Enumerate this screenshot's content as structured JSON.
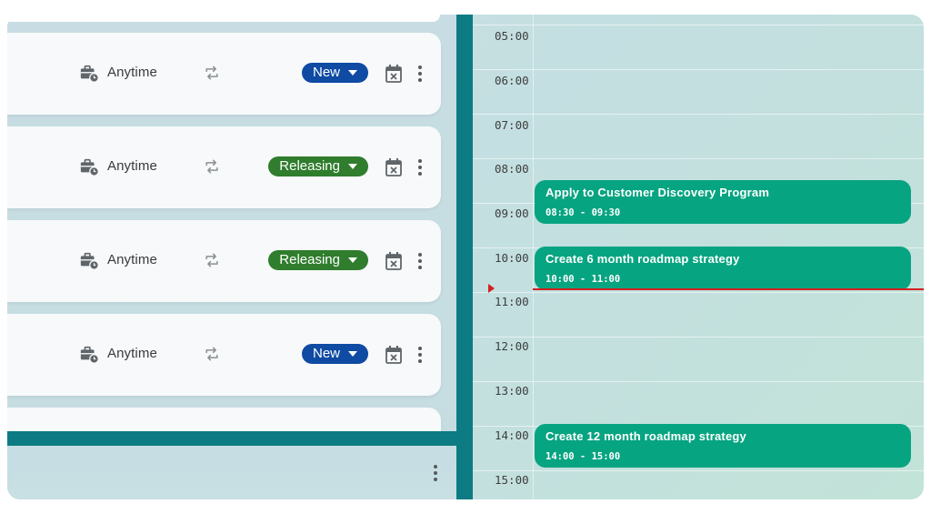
{
  "tasks": [
    {
      "when": "Anytime",
      "status": "New",
      "status_color": "#0f4aa3"
    },
    {
      "when": "Anytime",
      "status": "Releasing",
      "status_color": "#2f7d2d"
    },
    {
      "when": "Anytime",
      "status": "Releasing",
      "status_color": "#2f7d2d"
    },
    {
      "when": "Anytime",
      "status": "New",
      "status_color": "#0f4aa3"
    }
  ],
  "icons": {
    "schedule": "briefcase-clock-icon",
    "repeat": "repeat-icon",
    "calendar": "calendar-remove-icon",
    "menu": "more-vert-icon",
    "dropdown": "caret-down-icon"
  },
  "calendar": {
    "hours": [
      "05:00",
      "06:00",
      "07:00",
      "08:00",
      "09:00",
      "10:00",
      "11:00",
      "12:00",
      "13:00",
      "14:00",
      "15:00"
    ],
    "events": [
      {
        "title": "Apply to Customer Discovery Program",
        "time": "08:30 - 09:30"
      },
      {
        "title": "Create 6 month roadmap strategy",
        "time": "10:00 - 11:00"
      },
      {
        "title": "Create 12 month roadmap strategy",
        "time": "14:00 - 15:00"
      }
    ],
    "now_indicator_color": "#d21f1f",
    "event_color": "#07a481"
  },
  "colors": {
    "accent_teal": "#0d7b83",
    "status_new": "#0f4aa3",
    "status_releasing": "#2f7d2d"
  }
}
